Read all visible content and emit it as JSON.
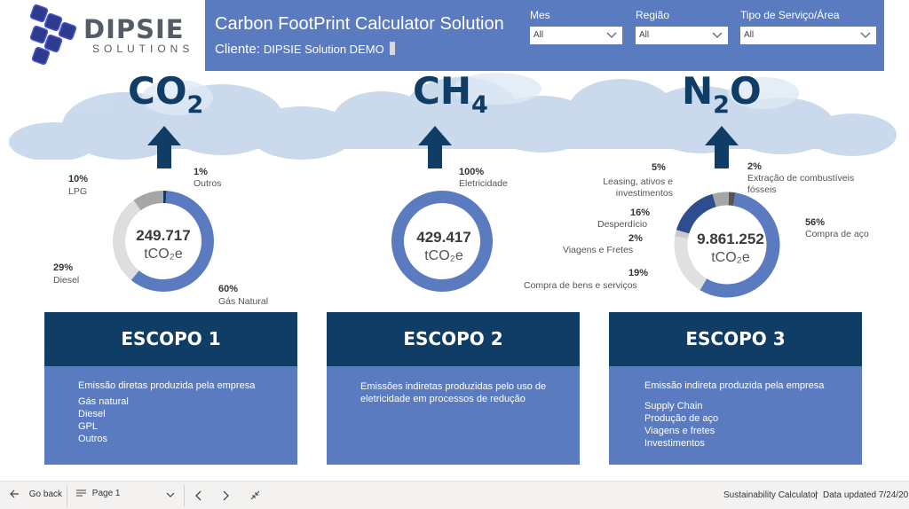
{
  "header": {
    "logo_text": "DIPSIE",
    "logo_tagline": "SOLUTIONS",
    "title": "Carbon FootPrint Calculator Solution",
    "client_label": "Cliente:",
    "client_value": "DIPSIE Solution DEMO",
    "filters": [
      {
        "label": "Mes",
        "value": "All"
      },
      {
        "label": "Região",
        "value": "All"
      },
      {
        "label": "Tipo de Serviço/Área",
        "value": "All"
      }
    ]
  },
  "gases": [
    {
      "base": "CO",
      "sub": "2"
    },
    {
      "base": "CH",
      "sub": "4"
    },
    {
      "base": "N",
      "sub": "2",
      "suffix": "O"
    }
  ],
  "donuts": [
    {
      "value": "249.717",
      "unit": "tCO₂e",
      "segments": [
        {
          "label": "Gás Natural",
          "pct": "60%",
          "share": 0.6,
          "color": "#5b7bc0"
        },
        {
          "label": "Diesel",
          "pct": "29%",
          "share": 0.29,
          "color": "#dedede"
        },
        {
          "label": "LPG",
          "pct": "10%",
          "share": 0.1,
          "color": "#a6a6a6"
        },
        {
          "label": "Outros",
          "pct": "1%",
          "share": 0.01,
          "color": "#0f3d66"
        }
      ]
    },
    {
      "value": "429.417",
      "unit": "tCO₂e",
      "segments": [
        {
          "label": "Eletricidade",
          "pct": "100%",
          "share": 1.0,
          "color": "#5b7bc0"
        }
      ]
    },
    {
      "value": "9.861.252",
      "unit": "tCO₂e",
      "segments": [
        {
          "label": "Compra de aço",
          "pct": "56%",
          "share": 0.56,
          "color": "#5b7bc0"
        },
        {
          "label": "Compra de bens e serviços",
          "pct": "19%",
          "share": 0.19,
          "color": "#e0e0e0"
        },
        {
          "label": "Viagens e Fretes",
          "pct": "2%",
          "share": 0.02,
          "color": "#c9c9c9"
        },
        {
          "label": "Desperdício",
          "pct": "16%",
          "share": 0.16,
          "color": "#2e4d8f"
        },
        {
          "label": "Leasing, ativos e investimentos",
          "pct": "5%",
          "share": 0.05,
          "color": "#a6a6a6"
        },
        {
          "label": "Extração de combustíveis fósseis",
          "pct": "2%",
          "share": 0.02,
          "color": "#555555"
        }
      ]
    }
  ],
  "scopes": [
    {
      "title": "ESCOPO 1",
      "description": "Emissão diretas produzida pela empresa",
      "items": [
        "Gás natural",
        "Diesel",
        "GPL",
        "Outros"
      ]
    },
    {
      "title": "ESCOPO 2",
      "description": "Emissões indiretas produzidas pelo uso de eletricidade em processos de redução",
      "items": []
    },
    {
      "title": "ESCOPO 3",
      "description": "Emissão indireta produzida pela empresa",
      "items": [
        "Supply Chain",
        "Produção de aço",
        "Viagens e fretes",
        "Investimentos"
      ]
    }
  ],
  "footer": {
    "back": "Go back",
    "page": "Page 1",
    "report_name": "Sustainability Calculator",
    "updated": "Data updated 7/24/20"
  },
  "colors": {
    "navy": "#0f3d66",
    "accent_blue": "#5b7bc0",
    "cloud": "#c8d7ec"
  }
}
